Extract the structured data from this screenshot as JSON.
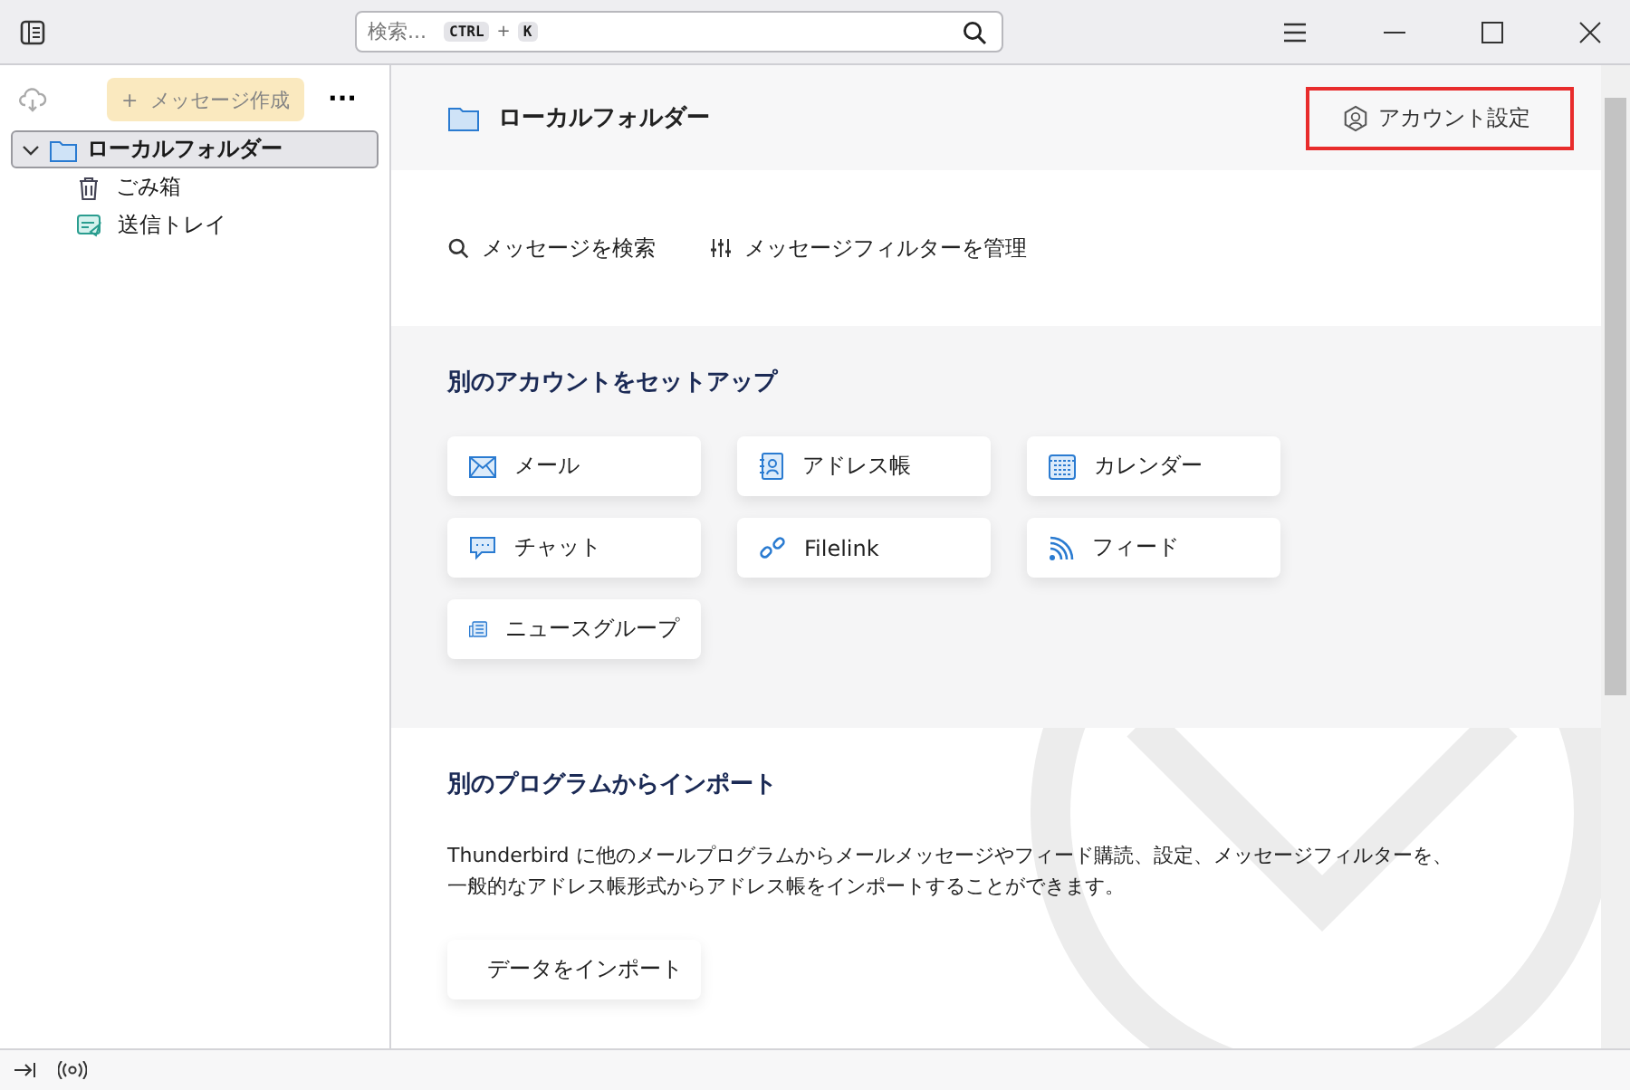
{
  "toolbar": {
    "search": {
      "placeholder": "検索...",
      "shortcut_keys": [
        "CTRL",
        "K"
      ],
      "shortcut_joiner": "+"
    }
  },
  "sidebar": {
    "compose_button": {
      "label": "メッセージ作成",
      "icon": "+",
      "disabled": true
    },
    "more_label": "···",
    "folders": [
      {
        "name": "ローカルフォルダー",
        "kind": "account",
        "selected": true,
        "expanded": true,
        "children": [
          {
            "name": "ごみ箱",
            "kind": "trash",
            "selected": false
          },
          {
            "name": "送信トレイ",
            "kind": "outbox",
            "selected": false
          }
        ]
      }
    ]
  },
  "header": {
    "title": "ローカルフォルダー",
    "account_settings": "アカウント設定"
  },
  "actions": [
    {
      "label": "メッセージを検索",
      "kind": "search"
    },
    {
      "label": "メッセージフィルターを管理",
      "kind": "filter"
    }
  ],
  "setup": {
    "heading": "別のアカウントをセットアップ",
    "cards": [
      {
        "label": "メール",
        "kind": "mail"
      },
      {
        "label": "アドレス帳",
        "kind": "addressbook"
      },
      {
        "label": "カレンダー",
        "kind": "calendar"
      },
      {
        "label": "チャット",
        "kind": "chat"
      },
      {
        "label": "Filelink",
        "kind": "link"
      },
      {
        "label": "フィード",
        "kind": "feed"
      },
      {
        "label": "ニュースグループ",
        "kind": "news"
      }
    ]
  },
  "import": {
    "heading": "別のプログラムからインポート",
    "text": "Thunderbird に他のメールプログラムからメールメッセージやフィード購読、設定、メッセージフィルターを、一般的なアドレス帳形式からアドレス帳をインポートすることができます。",
    "button": "データをインポート"
  }
}
